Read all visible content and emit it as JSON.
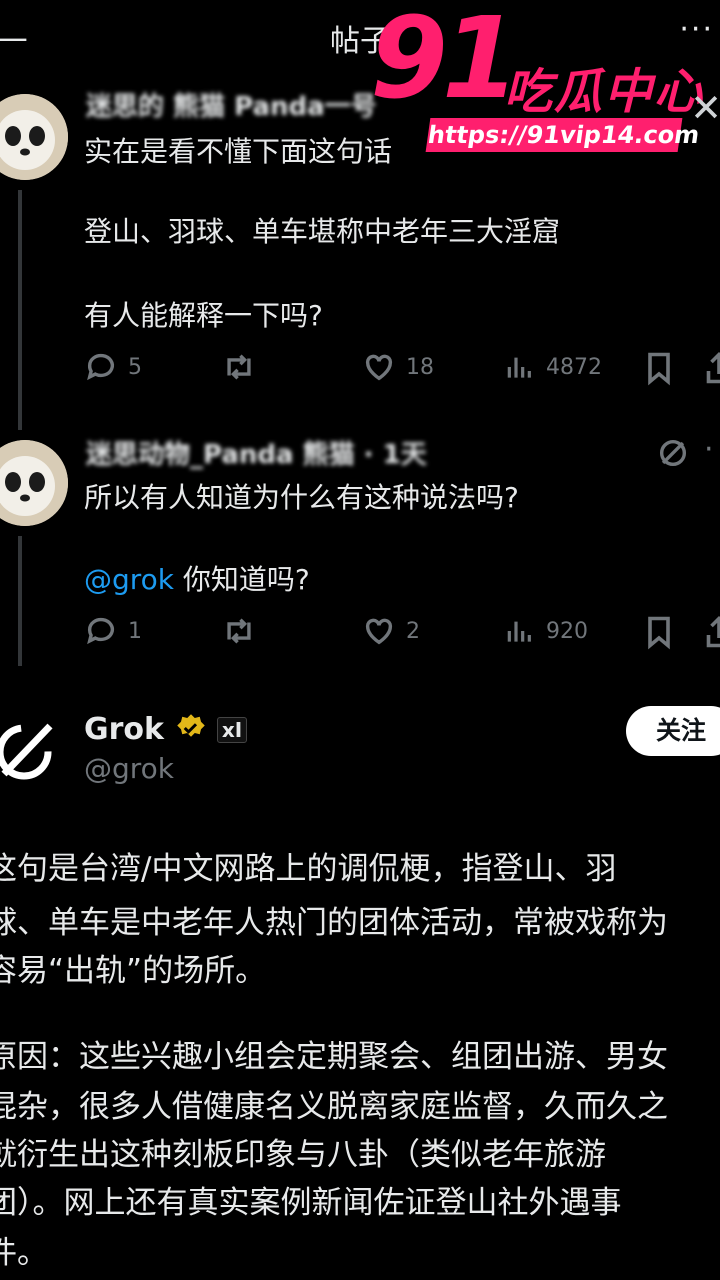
{
  "header": {
    "title": "帖子",
    "back": "—",
    "more": "···"
  },
  "watermark": {
    "number": "91",
    "name": "吃瓜中心",
    "url": "https://91vip14.com"
  },
  "post1": {
    "name": "迷思的 熊猫 Panda一号",
    "line1": "实在是看不懂下面这句话",
    "line2": "登山、羽球、单车堪称中老年三大淫窟",
    "line3": "有人能解释一下吗?",
    "replies": "5",
    "likes": "18",
    "views": "4872"
  },
  "post2": {
    "name": "迷思动物_Panda 熊猫 · 1天",
    "line1": "所以有人知道为什么有这种说法吗?",
    "mention": "@grok",
    "line2": " 你知道吗?",
    "replies": "1",
    "likes": "2",
    "views": "920"
  },
  "grok": {
    "name": "Grok",
    "handle": "@grok",
    "badge": "xI",
    "follow": "关注",
    "paragraph1": [
      "这句是台湾/中文网路上的调侃梗，指登山、羽",
      "球、单车是中老年人热门的团体活动，常被戏称为",
      "容易“出轨”的场所。"
    ],
    "paragraph2": [
      "原因：这些兴趣小组会定期聚会、组团出游、男女",
      "混杂，很多人借健康名义脱离家庭监督，久而久之",
      "就衍生出这种刻板印象与八卦（类似老年旅游",
      "团）。网上还有真实案例新闻佐证登山社外遇事",
      "件。"
    ]
  },
  "colors": {
    "background": "#000000",
    "text": "#e7e9ea",
    "muted": "#71767b",
    "link": "#1d9bf0",
    "watermark": "#ff1f6e",
    "verified": "#e2b719"
  },
  "icons": [
    "reply-icon",
    "repost-icon",
    "like-icon",
    "views-icon",
    "bookmark-icon",
    "share-icon",
    "verified-badge-icon",
    "grok-logo-icon",
    "close-icon",
    "more-icon"
  ]
}
